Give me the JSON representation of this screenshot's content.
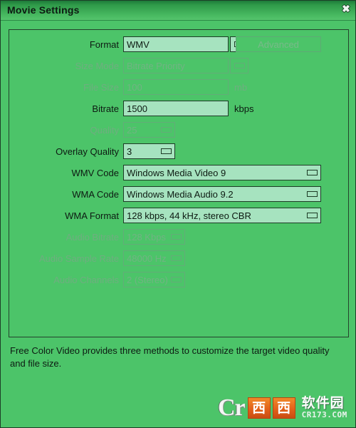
{
  "window": {
    "title": "Movie Settings",
    "close_label": "✖"
  },
  "form": {
    "rows": [
      {
        "label": "Format",
        "value": "WMV",
        "disabled": false,
        "control": "combo-split",
        "width": "w-medium",
        "unit": "",
        "extra_button": "Advanced"
      },
      {
        "label": "Size Mode",
        "value": "Bitrate Priority",
        "disabled": true,
        "control": "combo-split",
        "width": "w-medium",
        "unit": ""
      },
      {
        "label": "File Size",
        "value": "100",
        "disabled": true,
        "control": "text",
        "width": "w-medium",
        "unit": "mb"
      },
      {
        "label": "Bitrate",
        "value": "1500",
        "disabled": false,
        "control": "text",
        "width": "w-medium",
        "unit": "kbps"
      },
      {
        "label": "Quality",
        "value": "25",
        "disabled": true,
        "control": "combo-inline",
        "width": "w-narrow",
        "unit": ""
      },
      {
        "label": "Overlay Quality",
        "value": "3",
        "disabled": false,
        "control": "combo-inline",
        "width": "w-narrow",
        "unit": ""
      },
      {
        "label": "WMV Code",
        "value": "Windows Media Video 9",
        "disabled": false,
        "control": "combo-inline",
        "width": "w-wide",
        "unit": ""
      },
      {
        "label": "WMA Code",
        "value": "Windows Media Audio 9.2",
        "disabled": false,
        "control": "combo-inline",
        "width": "w-wide",
        "unit": ""
      },
      {
        "label": "WMA Format",
        "value": "128 kbps, 44 kHz, stereo CBR",
        "disabled": false,
        "control": "combo-inline",
        "width": "w-wide",
        "unit": ""
      },
      {
        "label": "Audio Bitrate",
        "value": "128 Kbps",
        "disabled": true,
        "control": "combo-inline",
        "width": "w-audio",
        "unit": ""
      },
      {
        "label": "Audio Sample Rate",
        "value": "48000 Hz",
        "disabled": true,
        "control": "combo-inline",
        "width": "w-audio",
        "unit": ""
      },
      {
        "label": "Audio Channels",
        "value": "2 (Stereo)",
        "disabled": true,
        "control": "combo-inline",
        "width": "w-audio",
        "unit": ""
      }
    ]
  },
  "note": {
    "text": "Free Color Video provides three methods to customize the target video quality and file size."
  },
  "watermark": {
    "mark": "Cr",
    "box1": "西",
    "box2": "西",
    "chinese": "软件园",
    "url": "CR173.COM"
  },
  "colors": {
    "title_bar_top": "#1e7a3a",
    "title_bar_bottom": "#55c56d",
    "body_bg": "#4cc469",
    "field_bg": "#a6e3bf",
    "border": "#1d3b26",
    "disabled_text": "#71b383",
    "accent_orange": "#e2611a"
  }
}
